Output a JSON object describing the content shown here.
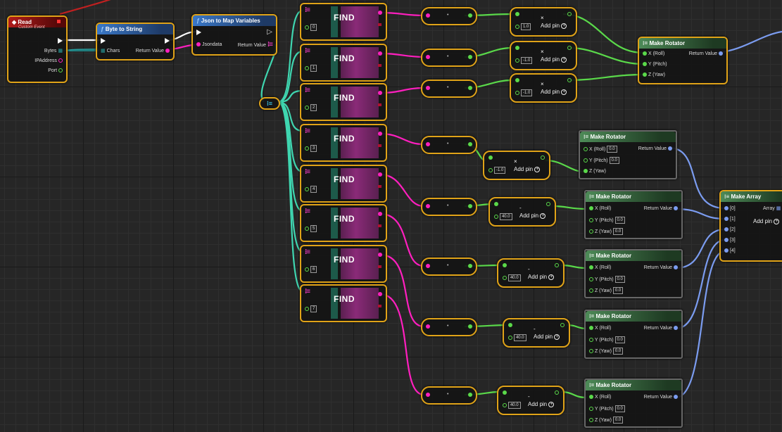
{
  "event_read": {
    "title": "Read",
    "subtitle": "Custom Event",
    "pins": [
      "Bytes",
      "IPAddress",
      "Port"
    ]
  },
  "byte_to_string": {
    "title": "Byte to String",
    "in_label": "Chars",
    "out_label": "Return Value"
  },
  "json_to_map": {
    "title": "Json to Map Variables",
    "in_label": "Jsondata",
    "out_label": "Return Value"
  },
  "find_nodes": [
    {
      "label": "FIND",
      "key": "0"
    },
    {
      "label": "FIND",
      "key": "1"
    },
    {
      "label": "FIND",
      "key": "2"
    },
    {
      "label": "FIND",
      "key": "3"
    },
    {
      "label": "FIND",
      "key": "4"
    },
    {
      "label": "FIND",
      "key": "5"
    },
    {
      "label": "FIND",
      "key": "6"
    },
    {
      "label": "FIND",
      "key": "7"
    }
  ],
  "conv_dot": "•",
  "math_nodes": [
    {
      "op": "×",
      "value": "1.0",
      "addpin": "Add pin"
    },
    {
      "op": "×",
      "value": "-1.0",
      "addpin": "Add pin"
    },
    {
      "op": "×",
      "value": "-1.0",
      "addpin": "Add pin"
    },
    {
      "op": "×",
      "value": "-1.0",
      "addpin": "Add pin"
    },
    {
      "op": "-",
      "value": "40.0",
      "addpin": "Add pin"
    },
    {
      "op": "-",
      "value": "40.0",
      "addpin": "Add pin"
    },
    {
      "op": "-",
      "value": "40.0",
      "addpin": "Add pin"
    },
    {
      "op": "-",
      "value": "40.0",
      "addpin": "Add pin"
    }
  ],
  "make_rotator_top": {
    "title": "Make Rotator",
    "pins": [
      "X (Roll)",
      "Y (Pitch)",
      "Z (Yaw)"
    ],
    "out_label": "Return Value"
  },
  "make_rotators": [
    {
      "title": "Make Rotator",
      "x_label": "X (Roll)",
      "y_label": "Y (Pitch)",
      "z_label": "Z (Yaw)",
      "x_val": "0.0",
      "y_val": "0.0",
      "z_val": "",
      "out_label": "Return Value"
    },
    {
      "title": "Make Rotator",
      "x_label": "X (Roll)",
      "y_label": "Y (Pitch)",
      "z_label": "Z (Yaw)",
      "x_val": "",
      "y_val": "0.0",
      "z_val": "0.0",
      "out_label": "Return Value"
    },
    {
      "title": "Make Rotator",
      "x_label": "X (Roll)",
      "y_label": "Y (Pitch)",
      "z_label": "Z (Yaw)",
      "x_val": "",
      "y_val": "0.0",
      "z_val": "0.0",
      "out_label": "Return Value"
    },
    {
      "title": "Make Rotator",
      "x_label": "X (Roll)",
      "y_label": "Y (Pitch)",
      "z_label": "Z (Yaw)",
      "x_val": "",
      "y_val": "0.0",
      "z_val": "0.0",
      "out_label": "Return Value"
    },
    {
      "title": "Make Rotator",
      "x_label": "X (Roll)",
      "y_label": "Y (Pitch)",
      "z_label": "Z (Yaw)",
      "x_val": "",
      "y_val": "0.0",
      "z_val": "0.0",
      "out_label": "Return Value"
    }
  ],
  "make_array": {
    "title": "Make Array",
    "pins": [
      "[0]",
      "[1]",
      "[2]",
      "[3]",
      "[4]"
    ],
    "out_label": "Array",
    "addpin": "Add pin"
  },
  "colors": {
    "node_border": "#e0a318",
    "exec": "#ffffff",
    "string_pin": "#ff1fbf",
    "float_pin": "#5ad94a",
    "map_wire": "#3fd6b0",
    "rotator_pin": "#7b9cf0",
    "function_header": "#3a78c8",
    "event_header": "#b01c1c"
  }
}
